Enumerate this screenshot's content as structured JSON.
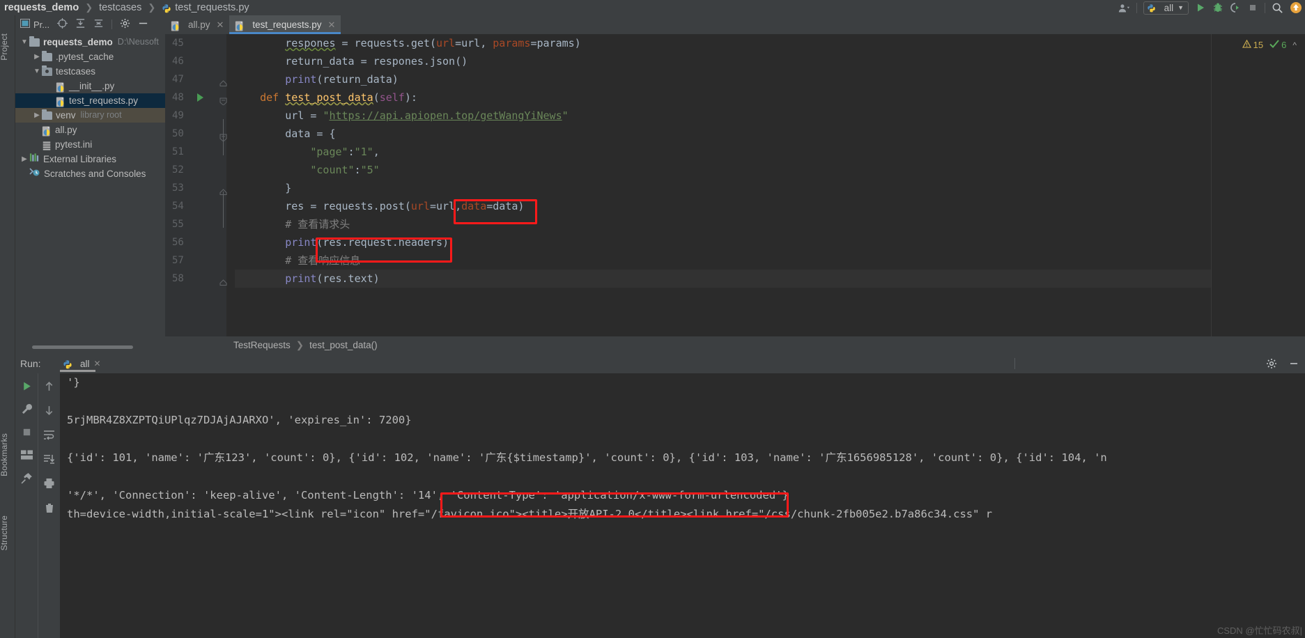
{
  "titlebar": {
    "breadcrumb": [
      "requests_demo",
      "testcases",
      "test_requests.py"
    ],
    "run_config": "all",
    "icons": [
      "user-avatar-icon",
      "run-icon",
      "debug-icon",
      "coverage-icon",
      "stop-icon",
      "search-icon",
      "update-icon"
    ]
  },
  "project_panel": {
    "title": "Pr...",
    "tree": [
      {
        "indent": 0,
        "arrow": "v",
        "icon": "folder-icon",
        "label": "requests_demo",
        "suffix": "D:\\Neusoft",
        "bold": true,
        "state": "normal"
      },
      {
        "indent": 1,
        "arrow": ">",
        "icon": "folder-icon",
        "label": ".pytest_cache",
        "suffix": "",
        "bold": false,
        "state": "normal"
      },
      {
        "indent": 1,
        "arrow": "v",
        "icon": "source-folder-icon",
        "label": "testcases",
        "suffix": "",
        "bold": false,
        "state": "normal"
      },
      {
        "indent": 2,
        "arrow": "",
        "icon": "python-file-icon",
        "label": "__init__.py",
        "suffix": "",
        "bold": false,
        "state": "normal"
      },
      {
        "indent": 2,
        "arrow": "",
        "icon": "python-file-icon",
        "label": "test_requests.py",
        "suffix": "",
        "bold": false,
        "state": "selected"
      },
      {
        "indent": 1,
        "arrow": ">",
        "icon": "folder-icon",
        "label": "venv",
        "suffix": "library root",
        "bold": false,
        "state": "highlighted"
      },
      {
        "indent": 1,
        "arrow": "",
        "icon": "python-file-icon",
        "label": "all.py",
        "suffix": "",
        "bold": false,
        "state": "normal"
      },
      {
        "indent": 1,
        "arrow": "",
        "icon": "ini-file-icon",
        "label": "pytest.ini",
        "suffix": "",
        "bold": false,
        "state": "normal"
      },
      {
        "indent": 0,
        "arrow": ">",
        "icon": "library-icon",
        "label": "External Libraries",
        "suffix": "",
        "bold": false,
        "state": "normal"
      },
      {
        "indent": 0,
        "arrow": "",
        "icon": "scratches-icon",
        "label": "Scratches and Consoles",
        "suffix": "",
        "bold": false,
        "state": "normal"
      }
    ]
  },
  "editor": {
    "tabs": [
      {
        "label": "all.py",
        "active": false
      },
      {
        "label": "test_requests.py",
        "active": true
      }
    ],
    "first_line_number": 45,
    "lines": [
      {
        "num": 45,
        "gutter_run": false,
        "fold": "",
        "current": false
      },
      {
        "num": 46,
        "gutter_run": false,
        "fold": "",
        "current": false
      },
      {
        "num": 47,
        "gutter_run": false,
        "fold": "end",
        "current": false
      },
      {
        "num": 48,
        "gutter_run": true,
        "fold": "start",
        "current": false
      },
      {
        "num": 49,
        "gutter_run": false,
        "fold": "",
        "current": false
      },
      {
        "num": 50,
        "gutter_run": false,
        "fold": "start",
        "current": false
      },
      {
        "num": 51,
        "gutter_run": false,
        "fold": "",
        "current": false
      },
      {
        "num": 52,
        "gutter_run": false,
        "fold": "",
        "current": false
      },
      {
        "num": 53,
        "gutter_run": false,
        "fold": "end",
        "current": false
      },
      {
        "num": 54,
        "gutter_run": false,
        "fold": "",
        "current": false
      },
      {
        "num": 55,
        "gutter_run": false,
        "fold": "",
        "current": false
      },
      {
        "num": 56,
        "gutter_run": false,
        "fold": "",
        "current": false
      },
      {
        "num": 57,
        "gutter_run": false,
        "fold": "",
        "current": false
      },
      {
        "num": 58,
        "gutter_run": false,
        "fold": "end",
        "current": true
      }
    ],
    "code_text": [
      "        respones = requests.get(url=url, params=params)",
      "        return_data = respones.json()",
      "        print(return_data)",
      "    def test_post_data(self):",
      "        url = \"https://api.apiopen.top/getWangYiNews\"",
      "        data = {",
      "            \"page\":\"1\",",
      "            \"count\":\"5\"",
      "        }",
      "        res = requests.post(url=url,data=data)",
      "        # 查看请求头",
      "        print(res.request.headers)",
      "        # 查看响应信息",
      "        print(res.text)"
    ],
    "inspection": {
      "warnings": "15",
      "checks": "6"
    },
    "breadcrumb": [
      "TestRequests",
      "test_post_data()"
    ],
    "annotations": [
      {
        "name": "data-param-highlight",
        "target": "data=data"
      },
      {
        "name": "request-headers-highlight",
        "target": "print(res.request.headers)"
      }
    ]
  },
  "run_panel": {
    "label": "Run:",
    "tab": "all",
    "toolbar_icons": [
      "rerun-icon",
      "settings-icon",
      "stop-icon",
      "layout-icon",
      "pin-icon",
      "scroll-up-icon",
      "scroll-down-icon",
      "soft-wrap-icon",
      "scroll-to-end-icon",
      "print-icon",
      "clear-all-icon"
    ],
    "right_icons": [
      "gear-icon",
      "collapse-icon"
    ],
    "output": [
      "'}",
      "",
      "5rjMBR4Z8XZPTQiUPlqz7DJAjAJARXO', 'expires_in': 7200}",
      "",
      "{'id': 101, 'name': '广东123', 'count': 0}, {'id': 102, 'name': '广东{$timestamp}', 'count': 0}, {'id': 103, 'name': '广东1656985128', 'count': 0}, {'id': 104, 'n",
      "",
      "'*/*', 'Connection': 'keep-alive', 'Content-Length': '14', 'Content-Type': 'application/x-www-form-urlencoded'}",
      "th=device-width,initial-scale=1\"><link rel=\"icon\" href=\"/favicon.ico\"><title>开放API-2.0</title><link href=\"/css/chunk-2fb005e2.b7a86c34.css\" r"
    ],
    "content_type_highlight": "'Content-Type': 'application/x-www-form-urlencoded'}"
  },
  "left_strip": {
    "labels": [
      "Project",
      "Bookmarks",
      "Structure"
    ]
  },
  "watermark": "CSDN @忙忙码农叔|",
  "colors": {
    "accent_blue": "#4a88c7",
    "selection": "#0d293e",
    "editor_bg": "#2b2b2b",
    "panel_bg": "#3c3f41",
    "highlight_red": "#ff1a1a",
    "string_green": "#6a8759",
    "keyword_orange": "#cc7832"
  }
}
